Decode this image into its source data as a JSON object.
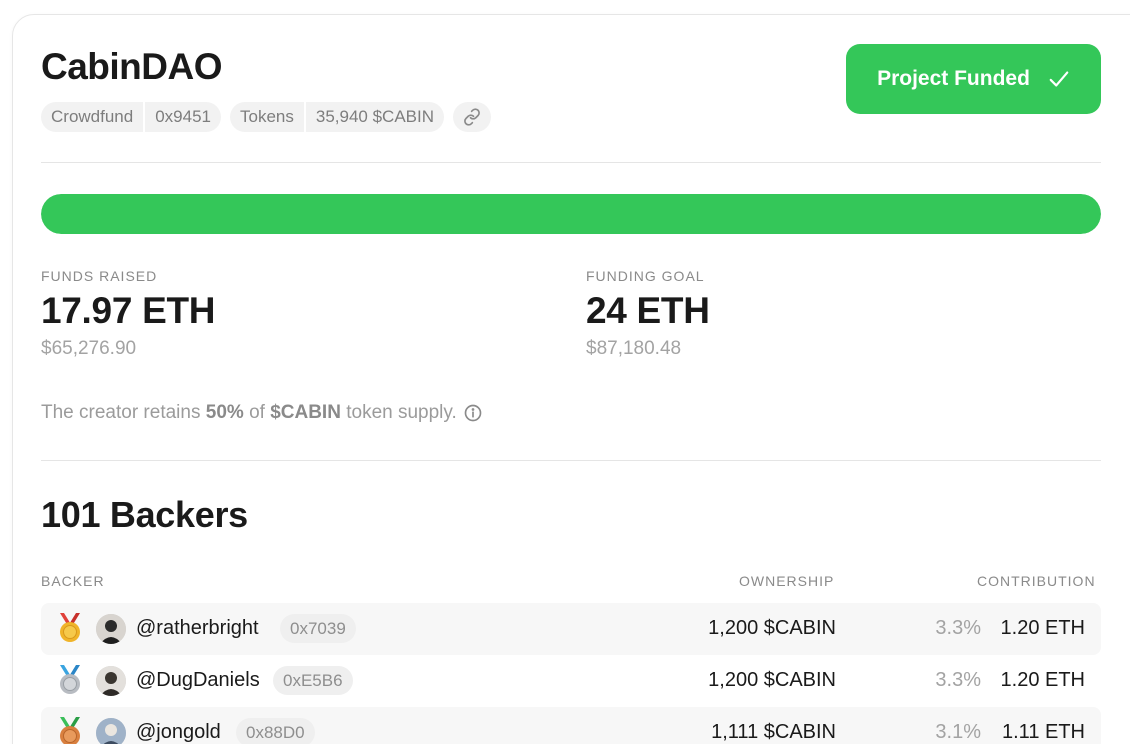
{
  "project": {
    "title": "CabinDAO",
    "chips": {
      "type_label": "Crowdfund",
      "type_address": "0x9451",
      "tokens_label": "Tokens",
      "tokens_value": "35,940 $CABIN"
    },
    "link_icon": "link-icon",
    "status_button": {
      "label": "Project Funded",
      "icon": "checkmark-icon"
    }
  },
  "funding": {
    "progress_fraction": 1.0,
    "accent_color": "#34c759",
    "raised": {
      "label": "FUNDS RAISED",
      "value": "17.97 ETH",
      "usd": "$65,276.90"
    },
    "goal": {
      "label": "FUNDING GOAL",
      "value": "24 ETH",
      "usd": "$87,180.48"
    },
    "retains": {
      "prefix": "The creator retains",
      "percent": "50%",
      "middle": "of",
      "token": "$CABIN",
      "suffix": "token supply.",
      "icon": "info-icon"
    }
  },
  "backers": {
    "title": "101 Backers",
    "columns": {
      "backer": "BACKER",
      "ownership": "OWNERSHIP",
      "contribution": "CONTRIBUTION"
    },
    "rows": [
      {
        "medal": "gold-medal-icon",
        "handle": "@ratherbright",
        "address": "0x7039",
        "ownership": "1,200 $CABIN",
        "percent": "3.3%",
        "contribution": "1.20 ETH"
      },
      {
        "medal": "silver-medal-icon",
        "handle": "@DugDaniels",
        "address": "0xE5B6",
        "ownership": "1,200 $CABIN",
        "percent": "3.3%",
        "contribution": "1.20 ETH"
      },
      {
        "medal": "bronze-medal-icon",
        "handle": "@jongold",
        "address": "0x88D0",
        "ownership": "1,111 $CABIN",
        "percent": "3.1%",
        "contribution": "1.11 ETH"
      }
    ]
  }
}
